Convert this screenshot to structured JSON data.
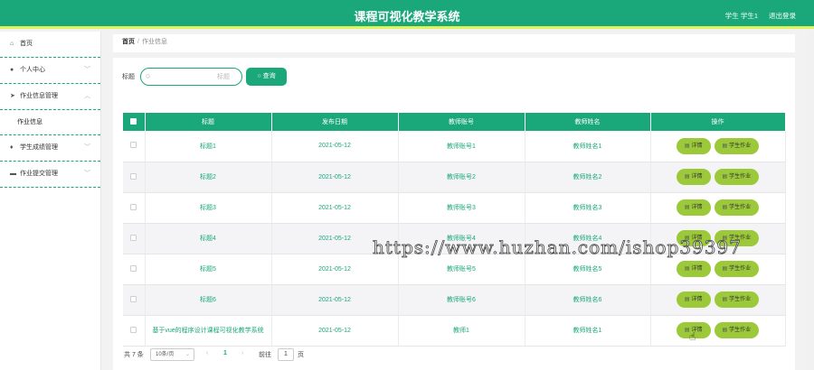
{
  "header": {
    "title": "课程可视化教学系统",
    "user": "学生 学生1",
    "logout": "退出登录"
  },
  "sidebar": {
    "items": [
      {
        "label": "首页",
        "icon": "home-icon",
        "glyph": "⌂",
        "chev": ""
      },
      {
        "label": "个人中心",
        "icon": "user-icon",
        "glyph": "●",
        "chev": "﹀"
      },
      {
        "label": "作业信息管理",
        "icon": "send-icon",
        "glyph": "➤",
        "chev": "︿"
      },
      {
        "label": "学生成绩管理",
        "icon": "mic-icon",
        "glyph": "♦",
        "chev": "﹀"
      },
      {
        "label": "作业提交管理",
        "icon": "chat-icon",
        "glyph": "▬",
        "chev": "﹀"
      }
    ],
    "sub_item": "作业信息"
  },
  "breadcrumb": {
    "home": "首页",
    "sep": "/",
    "current": "作业信息"
  },
  "search": {
    "label": "标题",
    "placeholder": "标题",
    "button": "查询",
    "button_icon": "search-icon"
  },
  "table": {
    "headers": [
      "标题",
      "发布日期",
      "教师账号",
      "教师姓名",
      "操作"
    ],
    "rows": [
      {
        "title": "标题1",
        "date": "2021-05-12",
        "account": "教师账号1",
        "name": "教师姓名1"
      },
      {
        "title": "标题2",
        "date": "2021-05-12",
        "account": "教师账号2",
        "name": "教师姓名2"
      },
      {
        "title": "标题3",
        "date": "2021-05-12",
        "account": "教师账号3",
        "name": "教师姓名3"
      },
      {
        "title": "标题4",
        "date": "2021-05-12",
        "account": "教师账号4",
        "name": "教师姓名4"
      },
      {
        "title": "标题5",
        "date": "2021-05-12",
        "account": "教师账号5",
        "name": "教师姓名5"
      },
      {
        "title": "标题6",
        "date": "2021-05-12",
        "account": "教师账号6",
        "name": "教师姓名6"
      },
      {
        "title": "基于vue的程序设计课程可视化教学系统",
        "date": "2021-05-12",
        "account": "教师1",
        "name": "教师姓名1"
      }
    ],
    "actions": {
      "detail": "详情",
      "submit": "学生作业"
    }
  },
  "pagination": {
    "total": "共 7 条",
    "page_size": "10条/页",
    "prev": "‹",
    "page": "1",
    "next": "›",
    "goto": "前往",
    "goto_value": "1",
    "unit": "页"
  },
  "watermark": "https://www.huzhan.com/ishop39397",
  "colors": {
    "primary": "#1aa77a",
    "accent_line": "#e4f25a",
    "action_button": "#9bc93a"
  }
}
